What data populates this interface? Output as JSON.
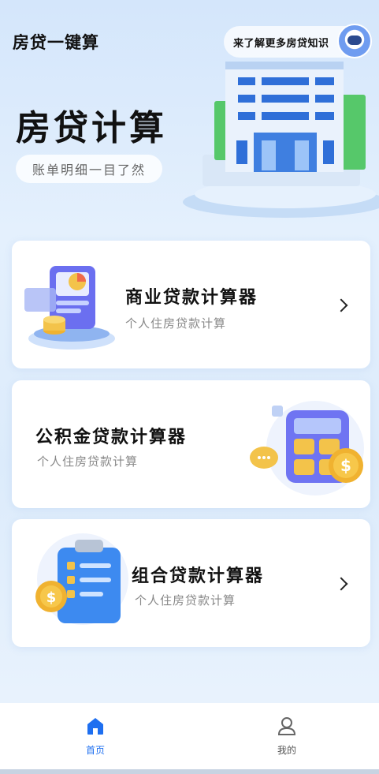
{
  "header": {
    "app_title": "房贷一键算",
    "learn_more": "来了解更多房贷知识",
    "hero_title": "房贷计算",
    "subtitle": "账单明细一目了然"
  },
  "cards": [
    {
      "title": "商业贷款计算器",
      "subtitle": "个人住房贷款计算"
    },
    {
      "title": "公积金贷款计算器",
      "subtitle": "个人住房贷款计算"
    },
    {
      "title": "组合贷款计算器",
      "subtitle": "个人住房贷款计算"
    }
  ],
  "tabbar": {
    "home": "首页",
    "mine": "我的"
  },
  "colors": {
    "accent": "#1e6ff0",
    "card_bg": "#ffffff",
    "page_bg": "#dcebfb"
  },
  "icons": {
    "home_tab": "home-icon",
    "mine_tab": "person-icon",
    "chevron": "chevron-right-icon"
  }
}
